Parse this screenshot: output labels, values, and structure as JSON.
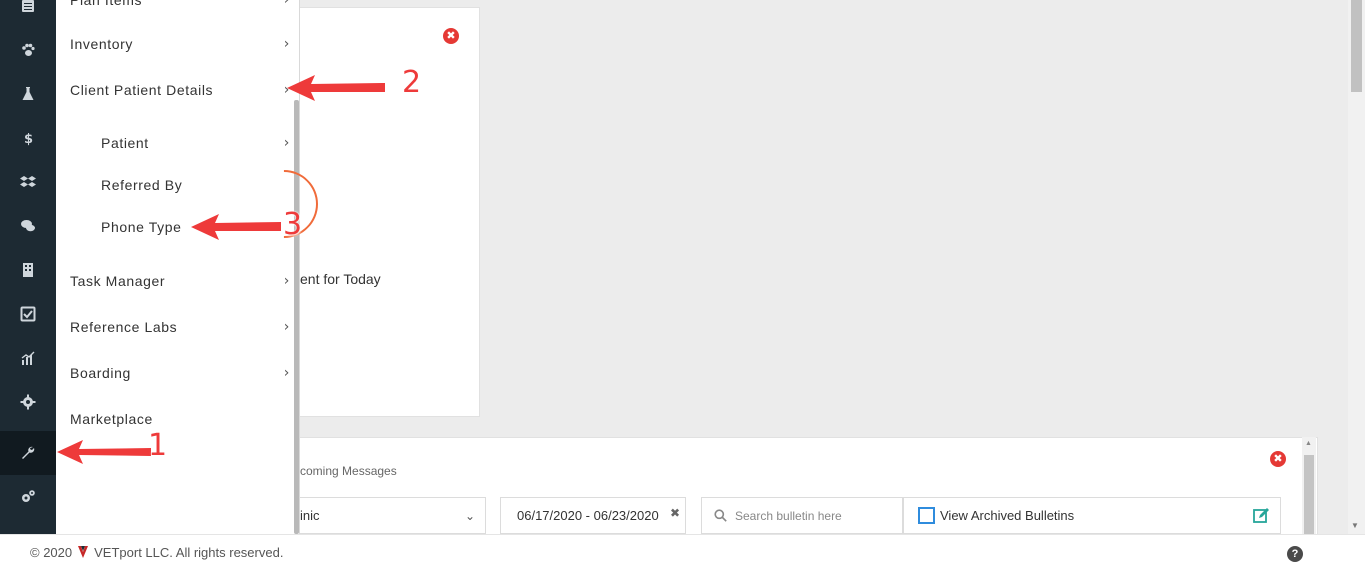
{
  "rail": {
    "items": [
      {
        "icon": "calendar-icon"
      },
      {
        "icon": "paw-icon"
      },
      {
        "icon": "flask-icon"
      },
      {
        "icon": "dollar-icon"
      },
      {
        "icon": "boxes-icon"
      },
      {
        "icon": "chat-icon"
      },
      {
        "icon": "building-icon"
      },
      {
        "icon": "checkbox-icon"
      },
      {
        "icon": "chart-icon"
      },
      {
        "icon": "gear-icon"
      },
      {
        "icon": "wrench-icon",
        "active": true
      },
      {
        "icon": "gears-icon"
      }
    ]
  },
  "menu": {
    "items": [
      {
        "label": "Plan Items"
      },
      {
        "label": "Inventory"
      },
      {
        "label": "Client Patient Details"
      },
      {
        "label": "Patient"
      },
      {
        "label": "Referred By"
      },
      {
        "label": "Phone Type"
      },
      {
        "label": "Task Manager"
      },
      {
        "label": "Reference Labs"
      },
      {
        "label": "Boarding"
      },
      {
        "label": "Marketplace"
      }
    ],
    "chevron": "›"
  },
  "card1": {
    "close": "✖",
    "appointment_text": "ent for Today"
  },
  "card2": {
    "close": "✖",
    "title": "coming Messages",
    "clinic_value": "inic",
    "date_range": "06/17/2020 - 06/23/2020",
    "date_clear": "✖",
    "search_placeholder": "Search bulletin here",
    "archived_label": "View Archived Bulletins"
  },
  "footer": {
    "copyright_prefix": "© 2020",
    "copyright_suffix": "VETport LLC. All rights reserved.",
    "help": "?"
  },
  "annotations": {
    "step1": "1",
    "step2": "2",
    "step3": "3",
    "color": "#ee3a3a"
  },
  "colors": {
    "rail_bg": "#1d2a33",
    "accent_close": "#e53935",
    "checkbox_blue": "#2f8cdd",
    "edit_green": "#26a69a"
  }
}
